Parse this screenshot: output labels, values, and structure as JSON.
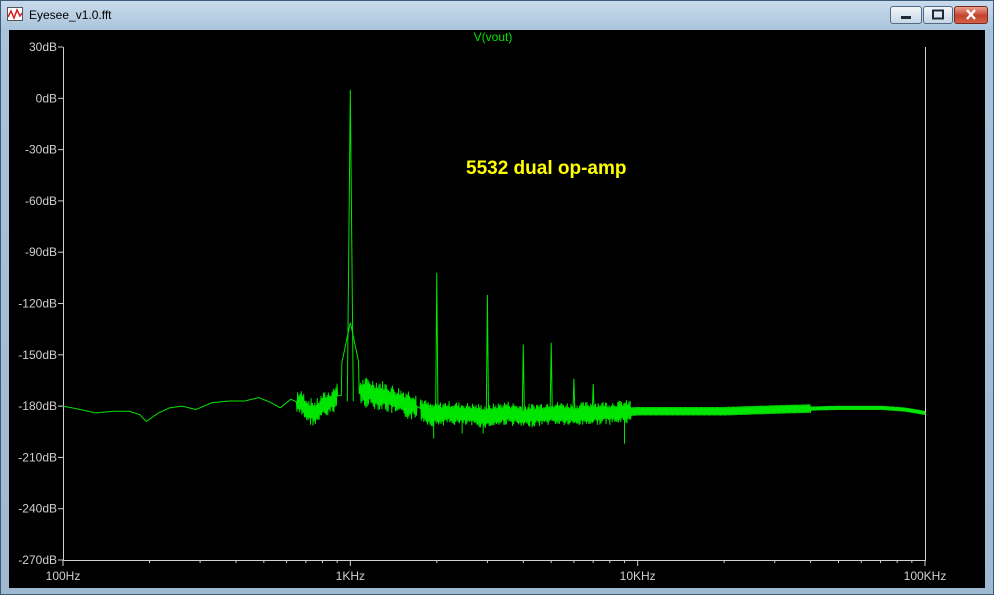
{
  "window": {
    "title": "Eyesee_v1.0.fft",
    "buttons": {
      "minimize_icon": "minimize-icon",
      "maximize_icon": "maximize-icon",
      "close_icon": "close-icon"
    }
  },
  "colors": {
    "trace": "#00e600",
    "text": "#cfcfcf",
    "annotation": "#ffff00",
    "background": "#000000"
  },
  "chart_data": {
    "type": "line",
    "title": "V(vout)",
    "annotation": "5532 dual op-amp",
    "x_scale": "log",
    "y_unit": "dB",
    "xlim": [
      100,
      100000
    ],
    "ylim": [
      -270,
      30
    ],
    "xticks": [
      {
        "value": 100,
        "label": "100Hz"
      },
      {
        "value": 1000,
        "label": "1KHz"
      },
      {
        "value": 10000,
        "label": "10KHz"
      },
      {
        "value": 100000,
        "label": "100KHz"
      }
    ],
    "yticks": [
      {
        "value": 30,
        "label": "30dB"
      },
      {
        "value": 0,
        "label": "0dB"
      },
      {
        "value": -30,
        "label": "-30dB"
      },
      {
        "value": -60,
        "label": "-60dB"
      },
      {
        "value": -90,
        "label": "-90dB"
      },
      {
        "value": -120,
        "label": "-120dB"
      },
      {
        "value": -150,
        "label": "-150dB"
      },
      {
        "value": -180,
        "label": "-180dB"
      },
      {
        "value": -210,
        "label": "-210dB"
      },
      {
        "value": -240,
        "label": "-240dB"
      },
      {
        "value": -270,
        "label": "-270dB"
      }
    ],
    "grid": false,
    "series": [
      {
        "noise_floor": [
          [
            100,
            -180
          ],
          [
            115,
            -182
          ],
          [
            130,
            -184
          ],
          [
            150,
            -183
          ],
          [
            170,
            -183
          ],
          [
            185,
            -185
          ],
          [
            195,
            -189
          ],
          [
            215,
            -184
          ],
          [
            235,
            -181
          ],
          [
            260,
            -180
          ],
          [
            290,
            -182
          ],
          [
            330,
            -178
          ],
          [
            380,
            -177
          ],
          [
            430,
            -177
          ],
          [
            480,
            -175
          ],
          [
            530,
            -178
          ],
          [
            570,
            -181
          ],
          [
            620,
            -176
          ],
          [
            680,
            -179
          ],
          [
            720,
            -183
          ],
          [
            760,
            -184
          ],
          [
            800,
            -180
          ],
          [
            850,
            -178
          ],
          [
            900,
            -174
          ],
          [
            1150,
            -172
          ],
          [
            1300,
            -174
          ],
          [
            1500,
            -178
          ],
          [
            1700,
            -180
          ],
          [
            1900,
            -185
          ],
          [
            2200,
            -184
          ],
          [
            2600,
            -185
          ],
          [
            3000,
            -186
          ],
          [
            3500,
            -184
          ],
          [
            4000,
            -186
          ],
          [
            5000,
            -184
          ],
          [
            6000,
            -185
          ],
          [
            7000,
            -184
          ],
          [
            8000,
            -184
          ],
          [
            10000,
            -183
          ],
          [
            15000,
            -183
          ],
          [
            20000,
            -183
          ],
          [
            30000,
            -182
          ],
          [
            50000,
            -181
          ],
          [
            70000,
            -181
          ],
          [
            85000,
            -182
          ],
          [
            100000,
            -184
          ]
        ],
        "peaks": [
          {
            "x": 1000,
            "y": 5
          },
          {
            "x": 2000,
            "y": -102
          },
          {
            "x": 3000,
            "y": -115
          },
          {
            "x": 4000,
            "y": -144
          },
          {
            "x": 5000,
            "y": -143
          },
          {
            "x": 6000,
            "y": -164
          },
          {
            "x": 7000,
            "y": -167
          }
        ]
      }
    ]
  }
}
